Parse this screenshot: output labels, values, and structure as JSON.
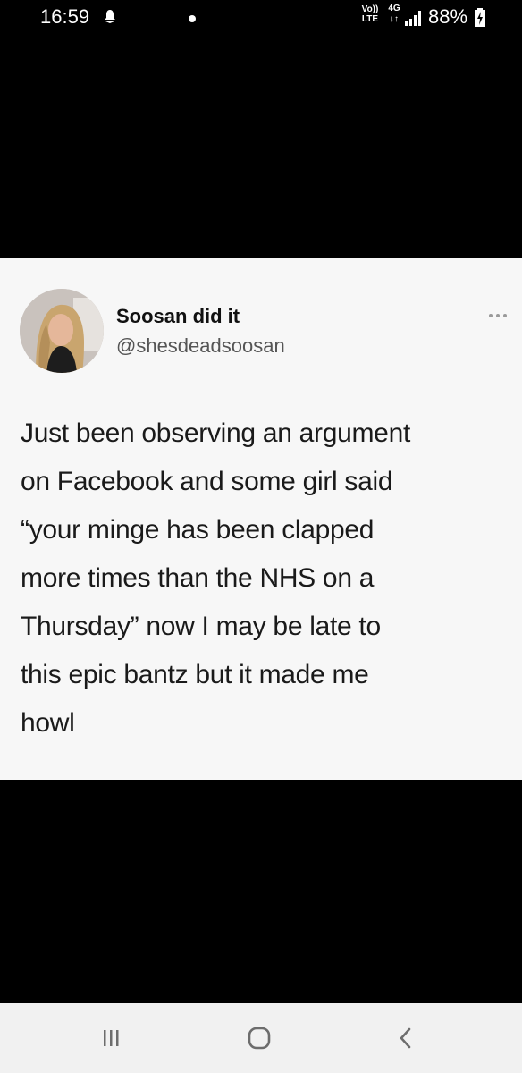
{
  "status_bar": {
    "time": "16:59",
    "volte_top": "Vo))",
    "volte_bottom": "LTE",
    "network_top": "4G",
    "network_bottom": "↓↑",
    "battery": "88%",
    "icons": [
      "notification-icon",
      "volte-icon",
      "signal-icon",
      "battery-charging-icon"
    ]
  },
  "tweet": {
    "display_name": "Soosan did it",
    "handle": "@shesdeadsoosan",
    "text_lines": [
      "Just been observing an argument",
      "on Facebook and some girl said",
      "“your minge has been clapped",
      "more times than the NHS on a",
      "Thursday” now I may be late to",
      "this epic bantz but it made me",
      "howl"
    ]
  },
  "nav_bar": {
    "buttons": [
      "recent-apps",
      "home",
      "back"
    ]
  },
  "colors": {
    "background": "#000000",
    "card": "#f7f7f7",
    "text": "#1a1a1a",
    "handle": "#555555",
    "nav_bar": "#f1f1f1",
    "nav_icon": "#6d6d6d"
  }
}
